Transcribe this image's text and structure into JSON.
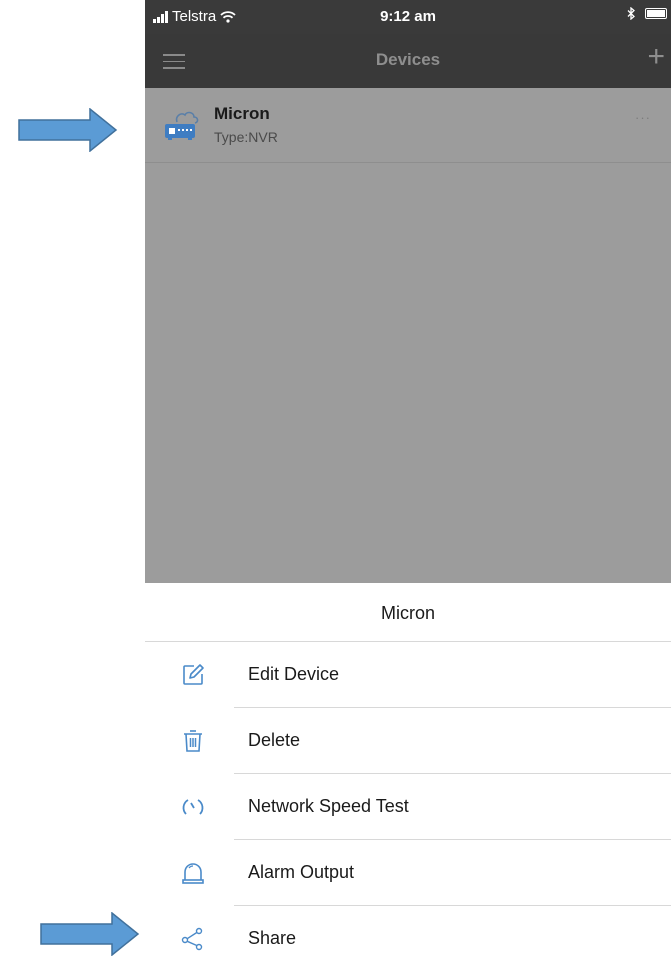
{
  "status_bar": {
    "carrier": "Telstra",
    "time": "9:12 am"
  },
  "nav": {
    "title": "Devices",
    "add_symbol": "+"
  },
  "device": {
    "name": "Micron",
    "type": "Type:NVR",
    "more": "···"
  },
  "sheet": {
    "title": "Micron",
    "items": [
      {
        "label": "Edit Device",
        "icon": "edit-icon"
      },
      {
        "label": "Delete",
        "icon": "trash-icon"
      },
      {
        "label": "Network Speed Test",
        "icon": "speedometer-icon"
      },
      {
        "label": "Alarm Output",
        "icon": "alarm-icon"
      },
      {
        "label": "Share",
        "icon": "share-icon"
      }
    ]
  },
  "colors": {
    "accent": "#4a8ac9",
    "nav_bg": "#393939",
    "dim_overlay": "#9c9c9c",
    "annotation_arrow": "#5b9bd5"
  }
}
